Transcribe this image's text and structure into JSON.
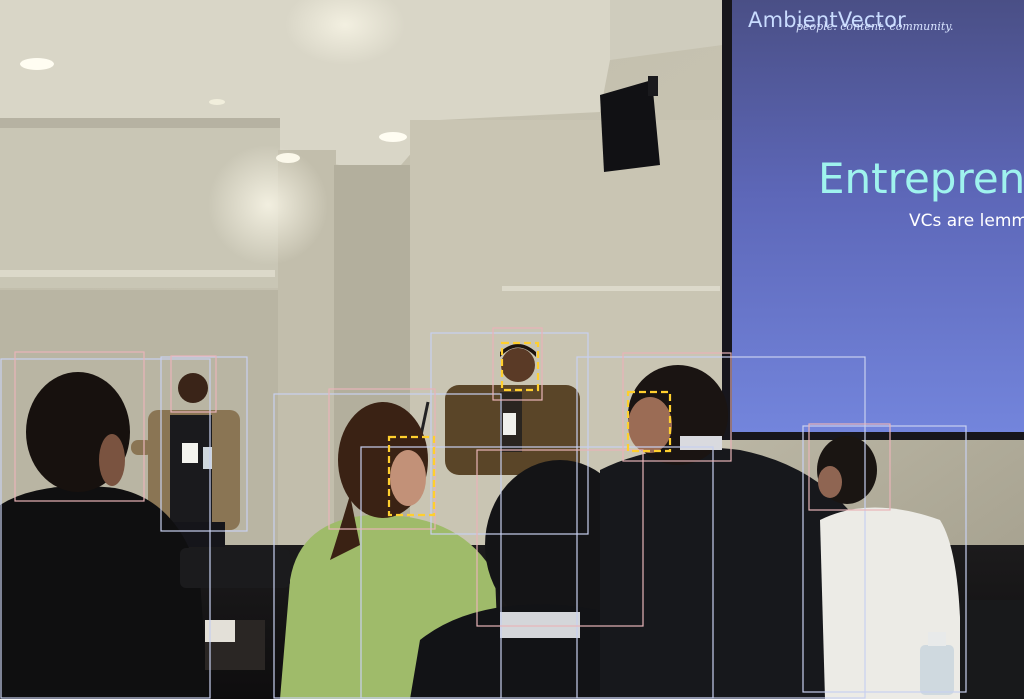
{
  "slide": {
    "brand": "AmbientVector",
    "tagline": "people. content. community.",
    "title": "Entreprene",
    "subtitle": "VCs are lemm"
  },
  "colors": {
    "person_box": "#c8d0f0",
    "face_box": "#e8b4b8",
    "dashed_face_box": "#ffcf2e",
    "projection_screen": "#6f7fd6"
  }
}
